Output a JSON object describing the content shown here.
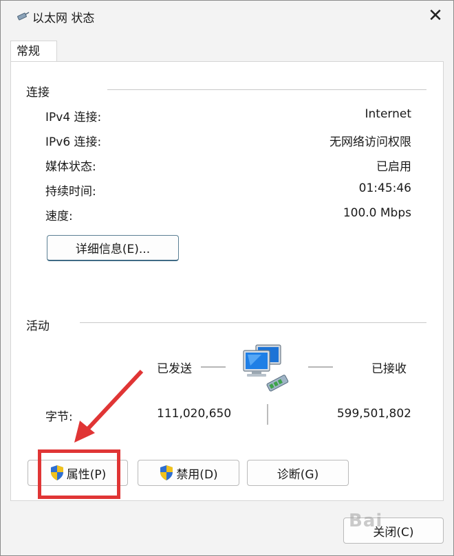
{
  "window": {
    "title": "以太网 状态"
  },
  "tabs": [
    {
      "label": "常规"
    }
  ],
  "connection": {
    "section_title": "连接",
    "rows": [
      {
        "label": "IPv4 连接:",
        "value": "Internet"
      },
      {
        "label": "IPv6 连接:",
        "value": "无网络访问权限"
      },
      {
        "label": "媒体状态:",
        "value": "已启用"
      },
      {
        "label": "持续时间:",
        "value": "01:45:46"
      },
      {
        "label": "速度:",
        "value": "100.0 Mbps"
      }
    ],
    "details_button": "详细信息(E)..."
  },
  "activity": {
    "section_title": "活动",
    "sent_label": "已发送",
    "received_label": "已接收",
    "bytes_label": "字节:",
    "bytes_sent": "111,020,650",
    "bytes_received": "599,501,802"
  },
  "buttons": {
    "properties": "属性(P)",
    "disable": "禁用(D)",
    "diagnose": "诊断(G)",
    "close": "关闭(C)"
  },
  "colors": {
    "highlight": "#e03535",
    "shield_blue": "#2f6fd1",
    "shield_yellow": "#f1c21b"
  }
}
